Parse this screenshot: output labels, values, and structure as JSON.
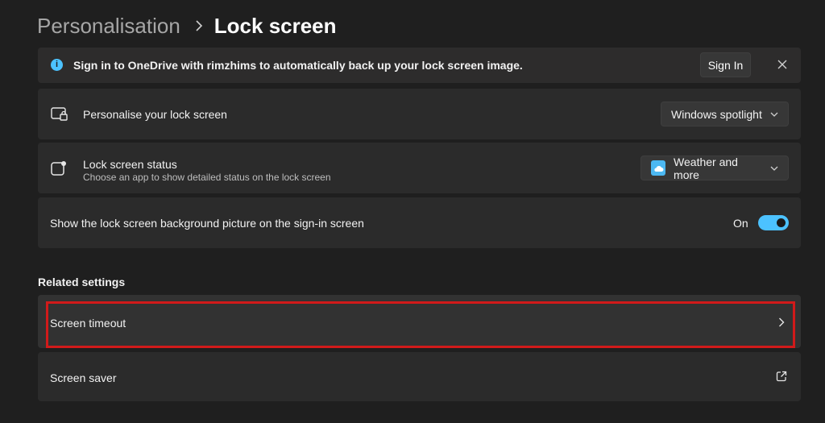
{
  "breadcrumb": {
    "parent": "Personalisation",
    "separator": "›",
    "current": "Lock screen"
  },
  "banner": {
    "icon": "info-icon",
    "message": "Sign in to OneDrive with rimzhims to automatically back up your lock screen image.",
    "sign_in_label": "Sign In",
    "close_icon": "close-icon"
  },
  "settings": {
    "personalise": {
      "icon": "lock-screen-icon",
      "title": "Personalise your lock screen",
      "value": "Windows spotlight"
    },
    "status": {
      "icon": "lock-screen-status-icon",
      "title": "Lock screen status",
      "subtitle": "Choose an app to show detailed status on the lock screen",
      "value": "Weather and more",
      "value_icon": "weather-icon"
    },
    "background_picture": {
      "title": "Show the lock screen background picture on the sign-in screen",
      "toggle_label": "On",
      "toggle_on": true
    }
  },
  "related": {
    "heading": "Related settings",
    "items": [
      {
        "label": "Screen timeout",
        "icon": "chevron-right-icon",
        "highlighted": true
      },
      {
        "label": "Screen saver",
        "icon": "external-link-icon"
      }
    ]
  },
  "colors": {
    "background": "#1f1f1f",
    "card": "#2b2b2b",
    "accent": "#4cc2ff",
    "highlight_border": "#d11a1a"
  }
}
